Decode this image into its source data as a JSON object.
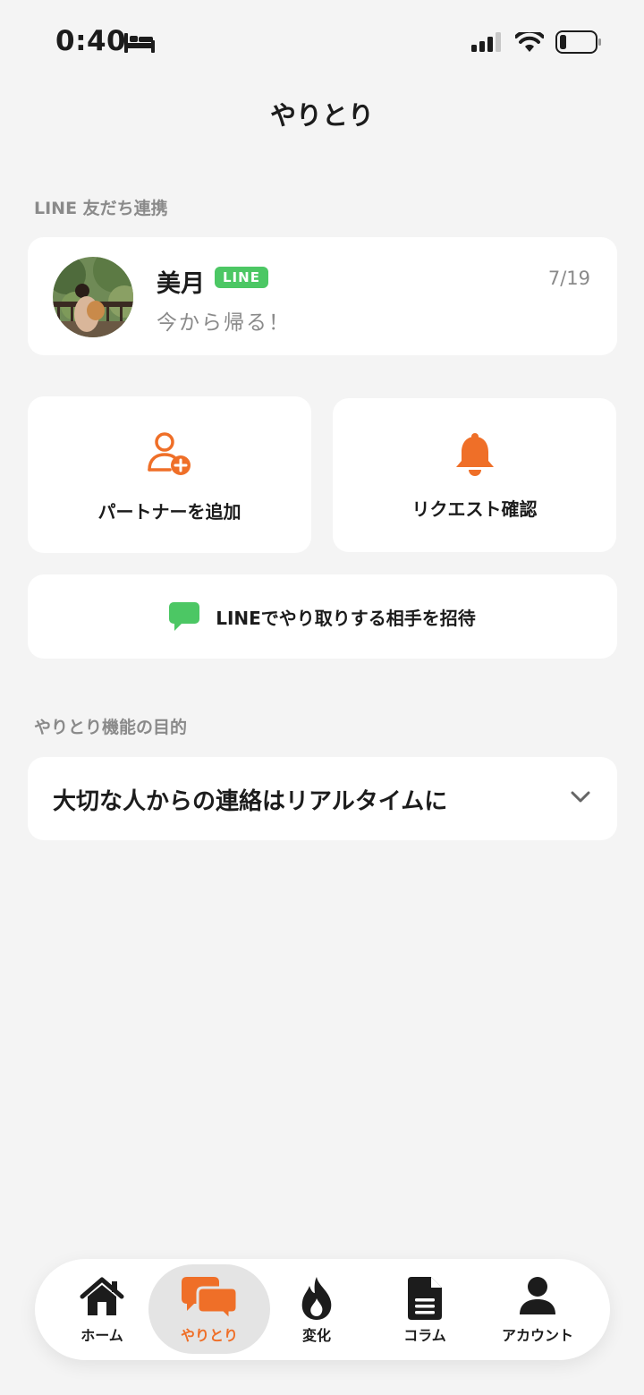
{
  "status_bar": {
    "time": "0:40"
  },
  "header": {
    "title": "やりとり"
  },
  "line_friends": {
    "section_label": "LINE 友だち連携",
    "friend": {
      "name": "美月",
      "badge": "LINE",
      "date": "7/19",
      "last_message": "今から帰る！"
    }
  },
  "actions": {
    "add_partner_label": "パートナーを追加",
    "request_check_label": "リクエスト確認",
    "invite_label": "LINEでやり取りする相手を招待"
  },
  "purpose": {
    "section_label": "やりとり機能の目的",
    "accordion_title": "大切な人からの連絡はリアルタイムに"
  },
  "tabs": [
    {
      "label": "ホーム",
      "icon": "home-icon",
      "active": false
    },
    {
      "label": "やりとり",
      "icon": "chat-bubbles-icon",
      "active": true
    },
    {
      "label": "変化",
      "icon": "flame-icon",
      "active": false
    },
    {
      "label": "コラム",
      "icon": "document-icon",
      "active": false
    },
    {
      "label": "アカウント",
      "icon": "person-icon",
      "active": false
    }
  ],
  "colors": {
    "accent": "#ef6f28",
    "line_green": "#4cc764",
    "background": "#f4f4f4"
  }
}
